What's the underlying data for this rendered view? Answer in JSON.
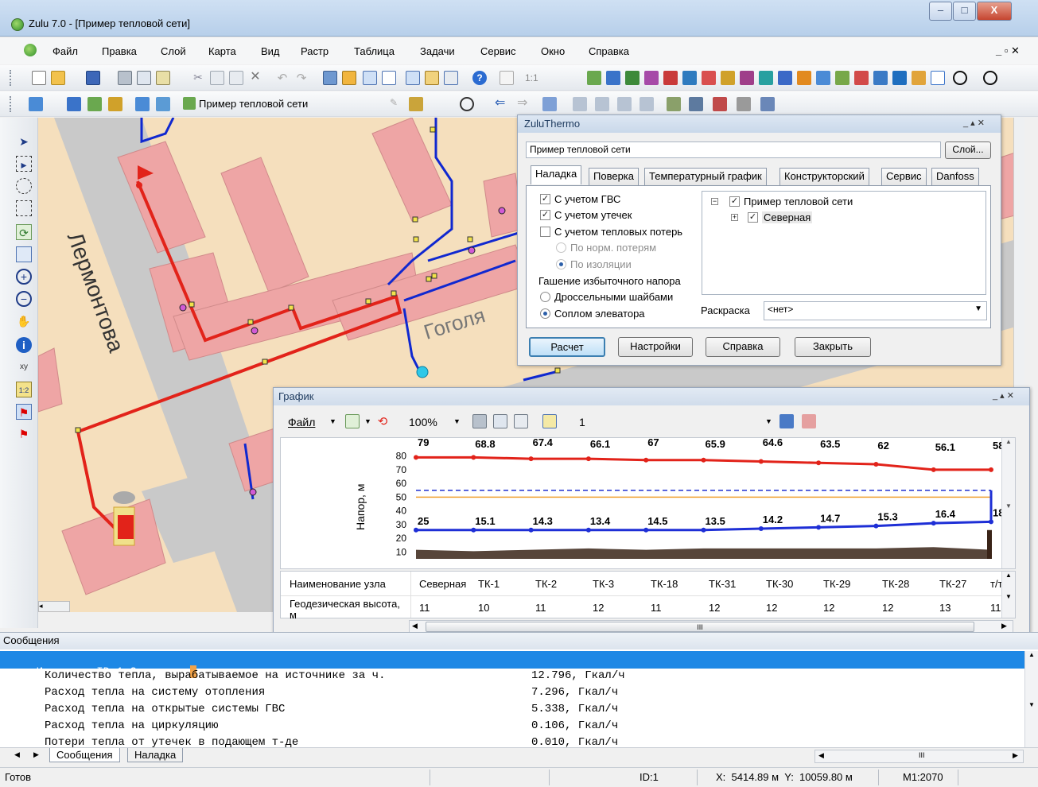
{
  "window": {
    "title": "Zulu 7.0 - [Пример тепловой сети]",
    "min": "–",
    "max": "□",
    "close": "X"
  },
  "menu": [
    {
      "label": "Файл"
    },
    {
      "label": "Правка"
    },
    {
      "label": "Слой"
    },
    {
      "label": "Карта"
    },
    {
      "label": "Вид"
    },
    {
      "label": "Растр"
    },
    {
      "label": "Таблица"
    },
    {
      "label": "Задачи"
    },
    {
      "label": "Сервис"
    },
    {
      "label": "Окно"
    },
    {
      "label": "Справка"
    }
  ],
  "mdi_controls": "_ ▫ ✕",
  "toolbar2": {
    "zoom_1_1": "1:1"
  },
  "toolbar3": {
    "layer_name": "Пример тепловой сети"
  },
  "map": {
    "street_1": "Лермонтова",
    "street_2": "Гоголя"
  },
  "zt": {
    "title": "ZuluThermo",
    "network": "Пример тепловой сети",
    "layer_btn": "Слой...",
    "tabs": [
      "Наладка",
      "Поверка",
      "Температурный график",
      "Конструкторский",
      "Сервис",
      "Danfoss"
    ],
    "opts": {
      "gvs": "С учетом ГВС",
      "leaks": "С учетом утечек",
      "heatloss": "С учетом тепловых потерь",
      "norm": "По норм. потерям",
      "insul": "По изоляции",
      "excess": "Гашение избыточного напора",
      "throttle": "Дроссельными шайбами",
      "nozzle": "Соплом элеватора"
    },
    "tree": {
      "root": "Пример тепловой сети",
      "child": "Северная"
    },
    "color_label": "Раскраска",
    "color_value": "<нет>",
    "buttons": {
      "calc": "Расчет",
      "settings": "Настройки",
      "help": "Справка",
      "close": "Закрыть"
    }
  },
  "graph": {
    "title": "График",
    "file": "Файл",
    "zoom": "100%",
    "page": "1",
    "ylabel": "Напор, м",
    "yticks": [
      "80",
      "70",
      "60",
      "50",
      "40",
      "30",
      "20",
      "10"
    ],
    "top_labels": [
      "79",
      "68.8",
      "67.4",
      "66.1",
      "67",
      "65.9",
      "64.6",
      "63.5",
      "62",
      "56.1",
      "58"
    ],
    "bottom_labels": [
      "25",
      "15.1",
      "14.3",
      "13.4",
      "14.5",
      "13.5",
      "14.2",
      "14.7",
      "15.3",
      "16.4",
      "18"
    ],
    "row1_header": "Наименование узла",
    "row2_header": "Геодезическая высота, м",
    "nodes": [
      "Северная",
      "ТК-1",
      "ТК-2",
      "ТК-3",
      "ТК-18",
      "ТК-31",
      "ТК-30",
      "ТК-29",
      "ТК-28",
      "ТК-27",
      "т/т"
    ],
    "heights": [
      "11",
      "10",
      "11",
      "12",
      "11",
      "12",
      "12",
      "12",
      "12",
      "13",
      "11"
    ],
    "hscroll": "III"
  },
  "chart_data": {
    "type": "line",
    "categories": [
      "Северная",
      "ТК-1",
      "ТК-2",
      "ТК-3",
      "ТК-18",
      "ТК-31",
      "ТК-30",
      "ТК-29",
      "ТК-28",
      "ТК-27",
      "т/т"
    ],
    "ylabel": "Напор, м",
    "ylim": [
      5,
      85
    ],
    "series": [
      {
        "values": [
          79,
          79,
          78,
          78,
          77,
          77,
          76,
          75,
          74,
          70,
          70
        ],
        "color": "#e2231a"
      },
      {
        "values": [
          50,
          50,
          50,
          50,
          50,
          50,
          50,
          50,
          50,
          50,
          50
        ],
        "color": "#f0a030"
      },
      {
        "values": [
          55,
          55,
          55,
          55,
          55,
          55,
          55,
          55,
          55,
          55,
          55
        ],
        "color": "#2030d0"
      },
      {
        "values": [
          26,
          26,
          26,
          26,
          26,
          26,
          27,
          28,
          29,
          31,
          32
        ],
        "color": "#1e2fd6"
      },
      {
        "values": [
          11,
          10,
          11,
          12,
          11,
          12,
          12,
          12,
          12,
          13,
          11
        ],
        "color": "#3a2418"
      }
    ]
  },
  "messages": {
    "header": "Сообщения",
    "source": "Источник ID=1 Северная:",
    "lines": [
      {
        "name": "Количество тепла, вырабатываемое на источнике за ч.",
        "value": "12.796, Гкал/ч"
      },
      {
        "name": "Расход тепла на систему отопления",
        "value": "7.296, Гкал/ч"
      },
      {
        "name": "Расход тепла на открытые системы ГВС",
        "value": "5.338, Гкал/ч"
      },
      {
        "name": "Расход тепла на циркуляцию",
        "value": "0.106, Гкал/ч"
      },
      {
        "name": "Потери тепла от утечек в подающем т-де",
        "value": "0.010, Гкал/ч"
      }
    ],
    "tabs": [
      "Сообщения",
      "Наладка"
    ],
    "hscroll": "III"
  },
  "status": {
    "ready": "Готов",
    "id": "ID:1",
    "coords": "X:  5414.89 м  Y:  10059.80 м",
    "scale": "M1:2070"
  }
}
